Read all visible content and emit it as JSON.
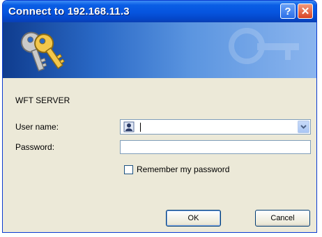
{
  "window": {
    "title": "Connect to 192.168.11.3",
    "help_glyph": "?",
    "close_glyph": "✕"
  },
  "banner": {
    "icon": "keys-icon"
  },
  "form": {
    "server_name": "WFT SERVER",
    "username_label": "User name:",
    "username_value": "",
    "password_label": "Password:",
    "password_value": "",
    "remember_label": "Remember my password",
    "remember_checked": false
  },
  "buttons": {
    "ok_label": "OK",
    "cancel_label": "Cancel"
  },
  "colors": {
    "titlebar": "#0654de",
    "dialog_bg": "#ece9d8",
    "banner_dark": "#0f3c8e",
    "banner_light": "#8bb5ee"
  }
}
